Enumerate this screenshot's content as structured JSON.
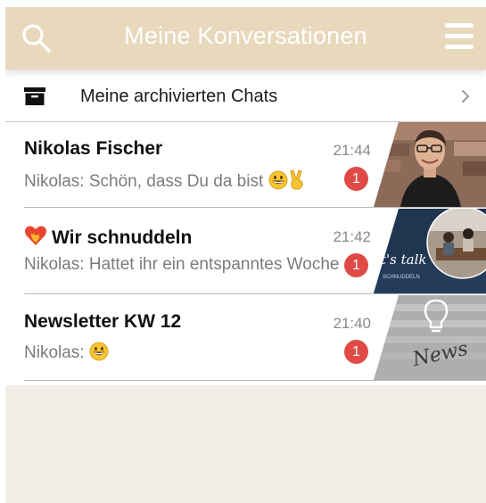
{
  "header": {
    "title": "Meine Konversationen",
    "search_icon": "search-icon",
    "menu_icon": "hamburger-menu-icon",
    "background_color": "#e8d8bc"
  },
  "archived": {
    "label": "Meine archivierten Chats",
    "icon": "archive-box-icon",
    "chevron": "chevron-right-icon"
  },
  "conversations": [
    {
      "name": "Nikolas Fischer",
      "preview": "Nikolas: Schön, dass Du da bist",
      "preview_emojis": [
        "grinning-face",
        "victory-hand"
      ],
      "time": "21:44",
      "unread": "1",
      "thumbnail": "person-portrait"
    },
    {
      "name": "Wir schnuddeln",
      "name_emoji": "heart-on-fire",
      "preview": "Nikolas: Hattet ihr ein entspanntes Woche",
      "time": "21:42",
      "unread": "1",
      "thumbnail": {
        "type": "lets-talk-graphic",
        "caption": "t's talk",
        "subcaption": "SCHNUDDELN"
      }
    },
    {
      "name": "Newsletter KW 12",
      "preview": "Nikolas:",
      "preview_emojis": [
        "grinning-face"
      ],
      "time": "21:40",
      "unread": "1",
      "thumbnail": {
        "type": "news-lightbulb-graphic",
        "caption": "News"
      }
    }
  ],
  "colors": {
    "badge": "#df4a46",
    "page_background": "#f3efe8"
  }
}
